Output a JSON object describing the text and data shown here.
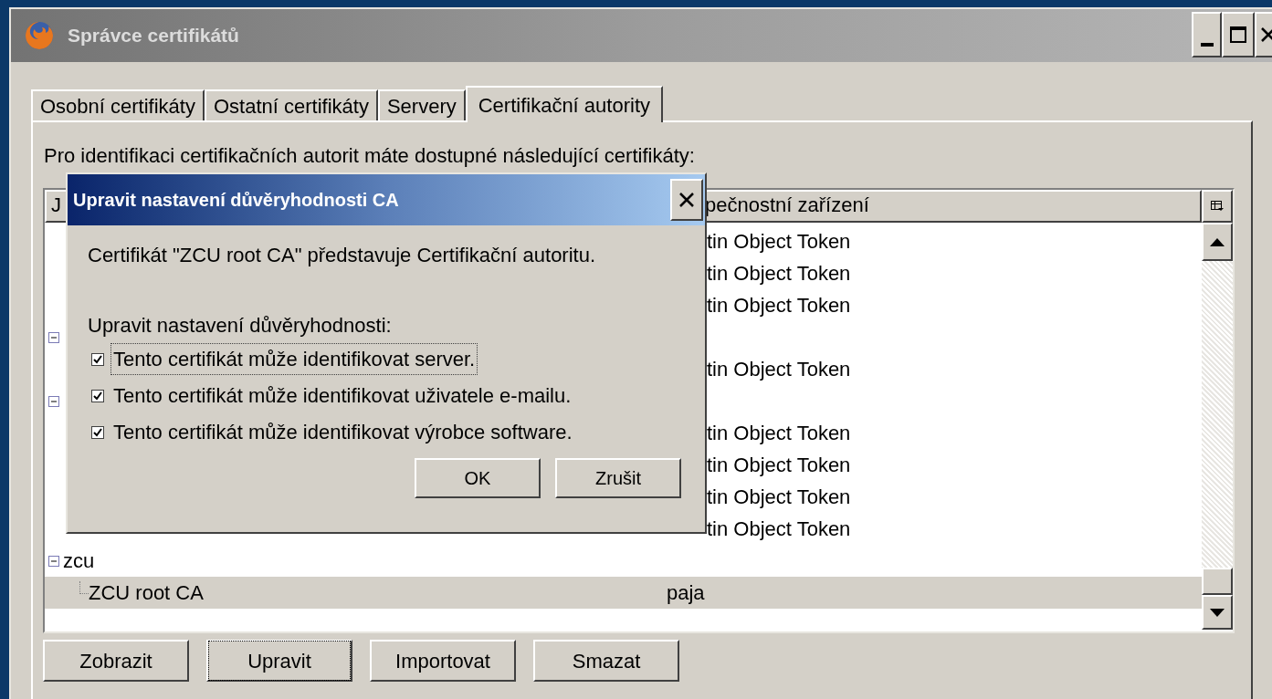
{
  "window": {
    "title": "Správce certifikátů"
  },
  "tabs": [
    {
      "label": "Osobní certifikáty",
      "selected": false
    },
    {
      "label": "Ostatní certifikáty",
      "selected": false
    },
    {
      "label": "Servery",
      "selected": false
    },
    {
      "label": "Certifikační autority",
      "selected": true
    }
  ],
  "description": "Pro identifikaci certifikačních autorit máte dostupné následující certifikáty:",
  "tree": {
    "columns": [
      "J",
      "pečnostní zařízení"
    ],
    "groups": [
      {
        "children": [
          {
            "column_2": "tin Object Token",
            "selected": false
          },
          {
            "column_2": "tin Object Token",
            "selected": false
          },
          {
            "column_2": "tin Object Token",
            "selected": false
          }
        ]
      },
      {
        "expanded": true,
        "children": [
          {
            "column_2": "tin Object Token",
            "selected": false
          }
        ]
      },
      {
        "expanded": true,
        "children": [
          {
            "column_2": "tin Object Token",
            "selected": false
          },
          {
            "column_2": "tin Object Token",
            "selected": false
          },
          {
            "column_2": "tin Object Token",
            "selected": false
          },
          {
            "column_2": "tin Object Token",
            "selected": false
          }
        ]
      },
      {
        "name": "zcu",
        "expanded": true,
        "children": [
          {
            "name": "ZCU root CA",
            "column_2": "paja",
            "selected": true
          }
        ]
      }
    ]
  },
  "buttons": [
    {
      "label": "Zobrazit",
      "focused": false
    },
    {
      "label": "Upravit",
      "focused": true
    },
    {
      "label": "Importovat",
      "focused": false
    },
    {
      "label": "Smazat",
      "focused": false
    }
  ],
  "dialog": {
    "title": "Upravit nastavení důvěryhodnosti CA",
    "message": "Certifikát \"ZCU root CA\" představuje Certifikační autoritu.",
    "section_label": "Upravit nastavení důvěryhodnosti:",
    "options": [
      {
        "label": "Tento certifikát může identifikovat server.",
        "checked": true,
        "focused": true
      },
      {
        "label": "Tento certifikát může identifikovat uživatele e-mailu.",
        "checked": true,
        "focused": false
      },
      {
        "label": "Tento certifikát může identifikovat výrobce software.",
        "checked": true,
        "focused": false
      }
    ],
    "buttons": [
      "OK",
      "Zrušit"
    ]
  }
}
